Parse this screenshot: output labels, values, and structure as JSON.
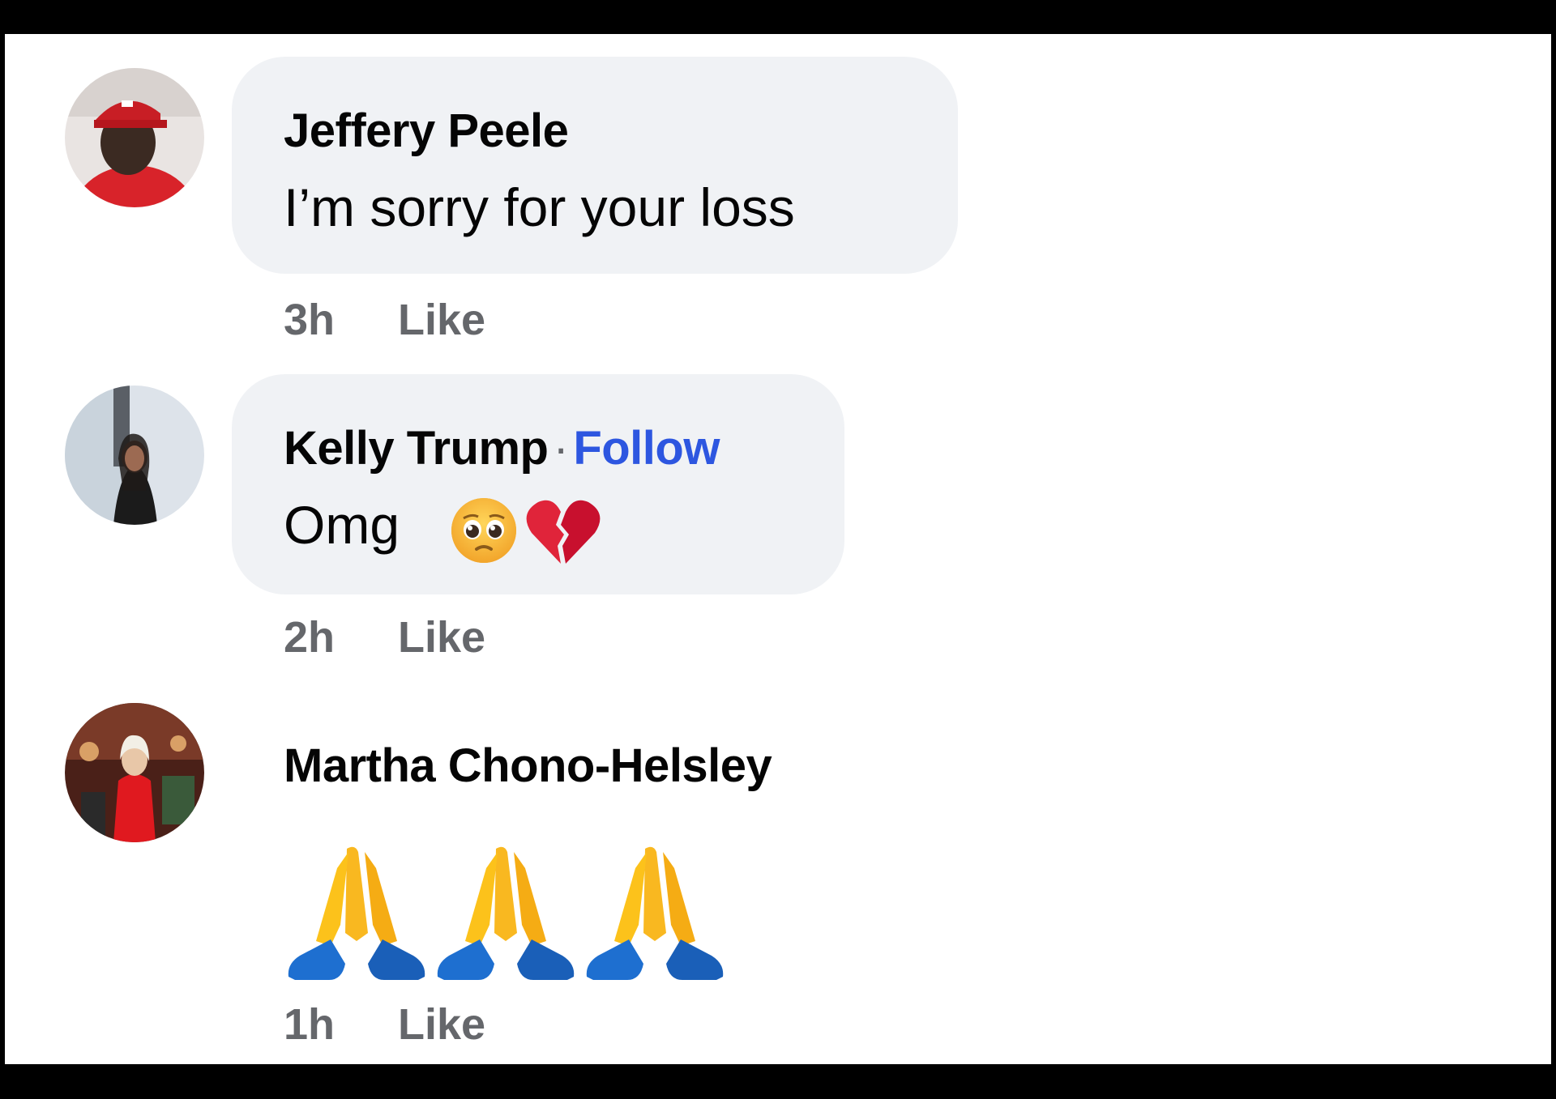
{
  "comments": [
    {
      "author": "Jeffery Peele",
      "text": "I’m sorry for your loss",
      "timestamp": "3h",
      "like_label": "Like",
      "avatar_icon": "profile-photo-red-cap"
    },
    {
      "author": "Kelly Trump",
      "separator": "·",
      "follow_label": "Follow",
      "text": "Omg",
      "emojis": [
        "pleading-face-emoji",
        "broken-heart-emoji"
      ],
      "timestamp": "2h",
      "like_label": "Like",
      "avatar_icon": "profile-photo-woman"
    },
    {
      "author": "Martha Chono-Helsley",
      "emojis": [
        "folded-hands-emoji",
        "folded-hands-emoji",
        "folded-hands-emoji"
      ],
      "timestamp": "1h",
      "like_label": "Like",
      "avatar_icon": "profile-photo-red-dress"
    }
  ],
  "colors": {
    "bubble": "#f0f2f5",
    "name": "#050505",
    "meta": "#65676b",
    "follow": "#2d56e0",
    "frame": "#000000"
  }
}
